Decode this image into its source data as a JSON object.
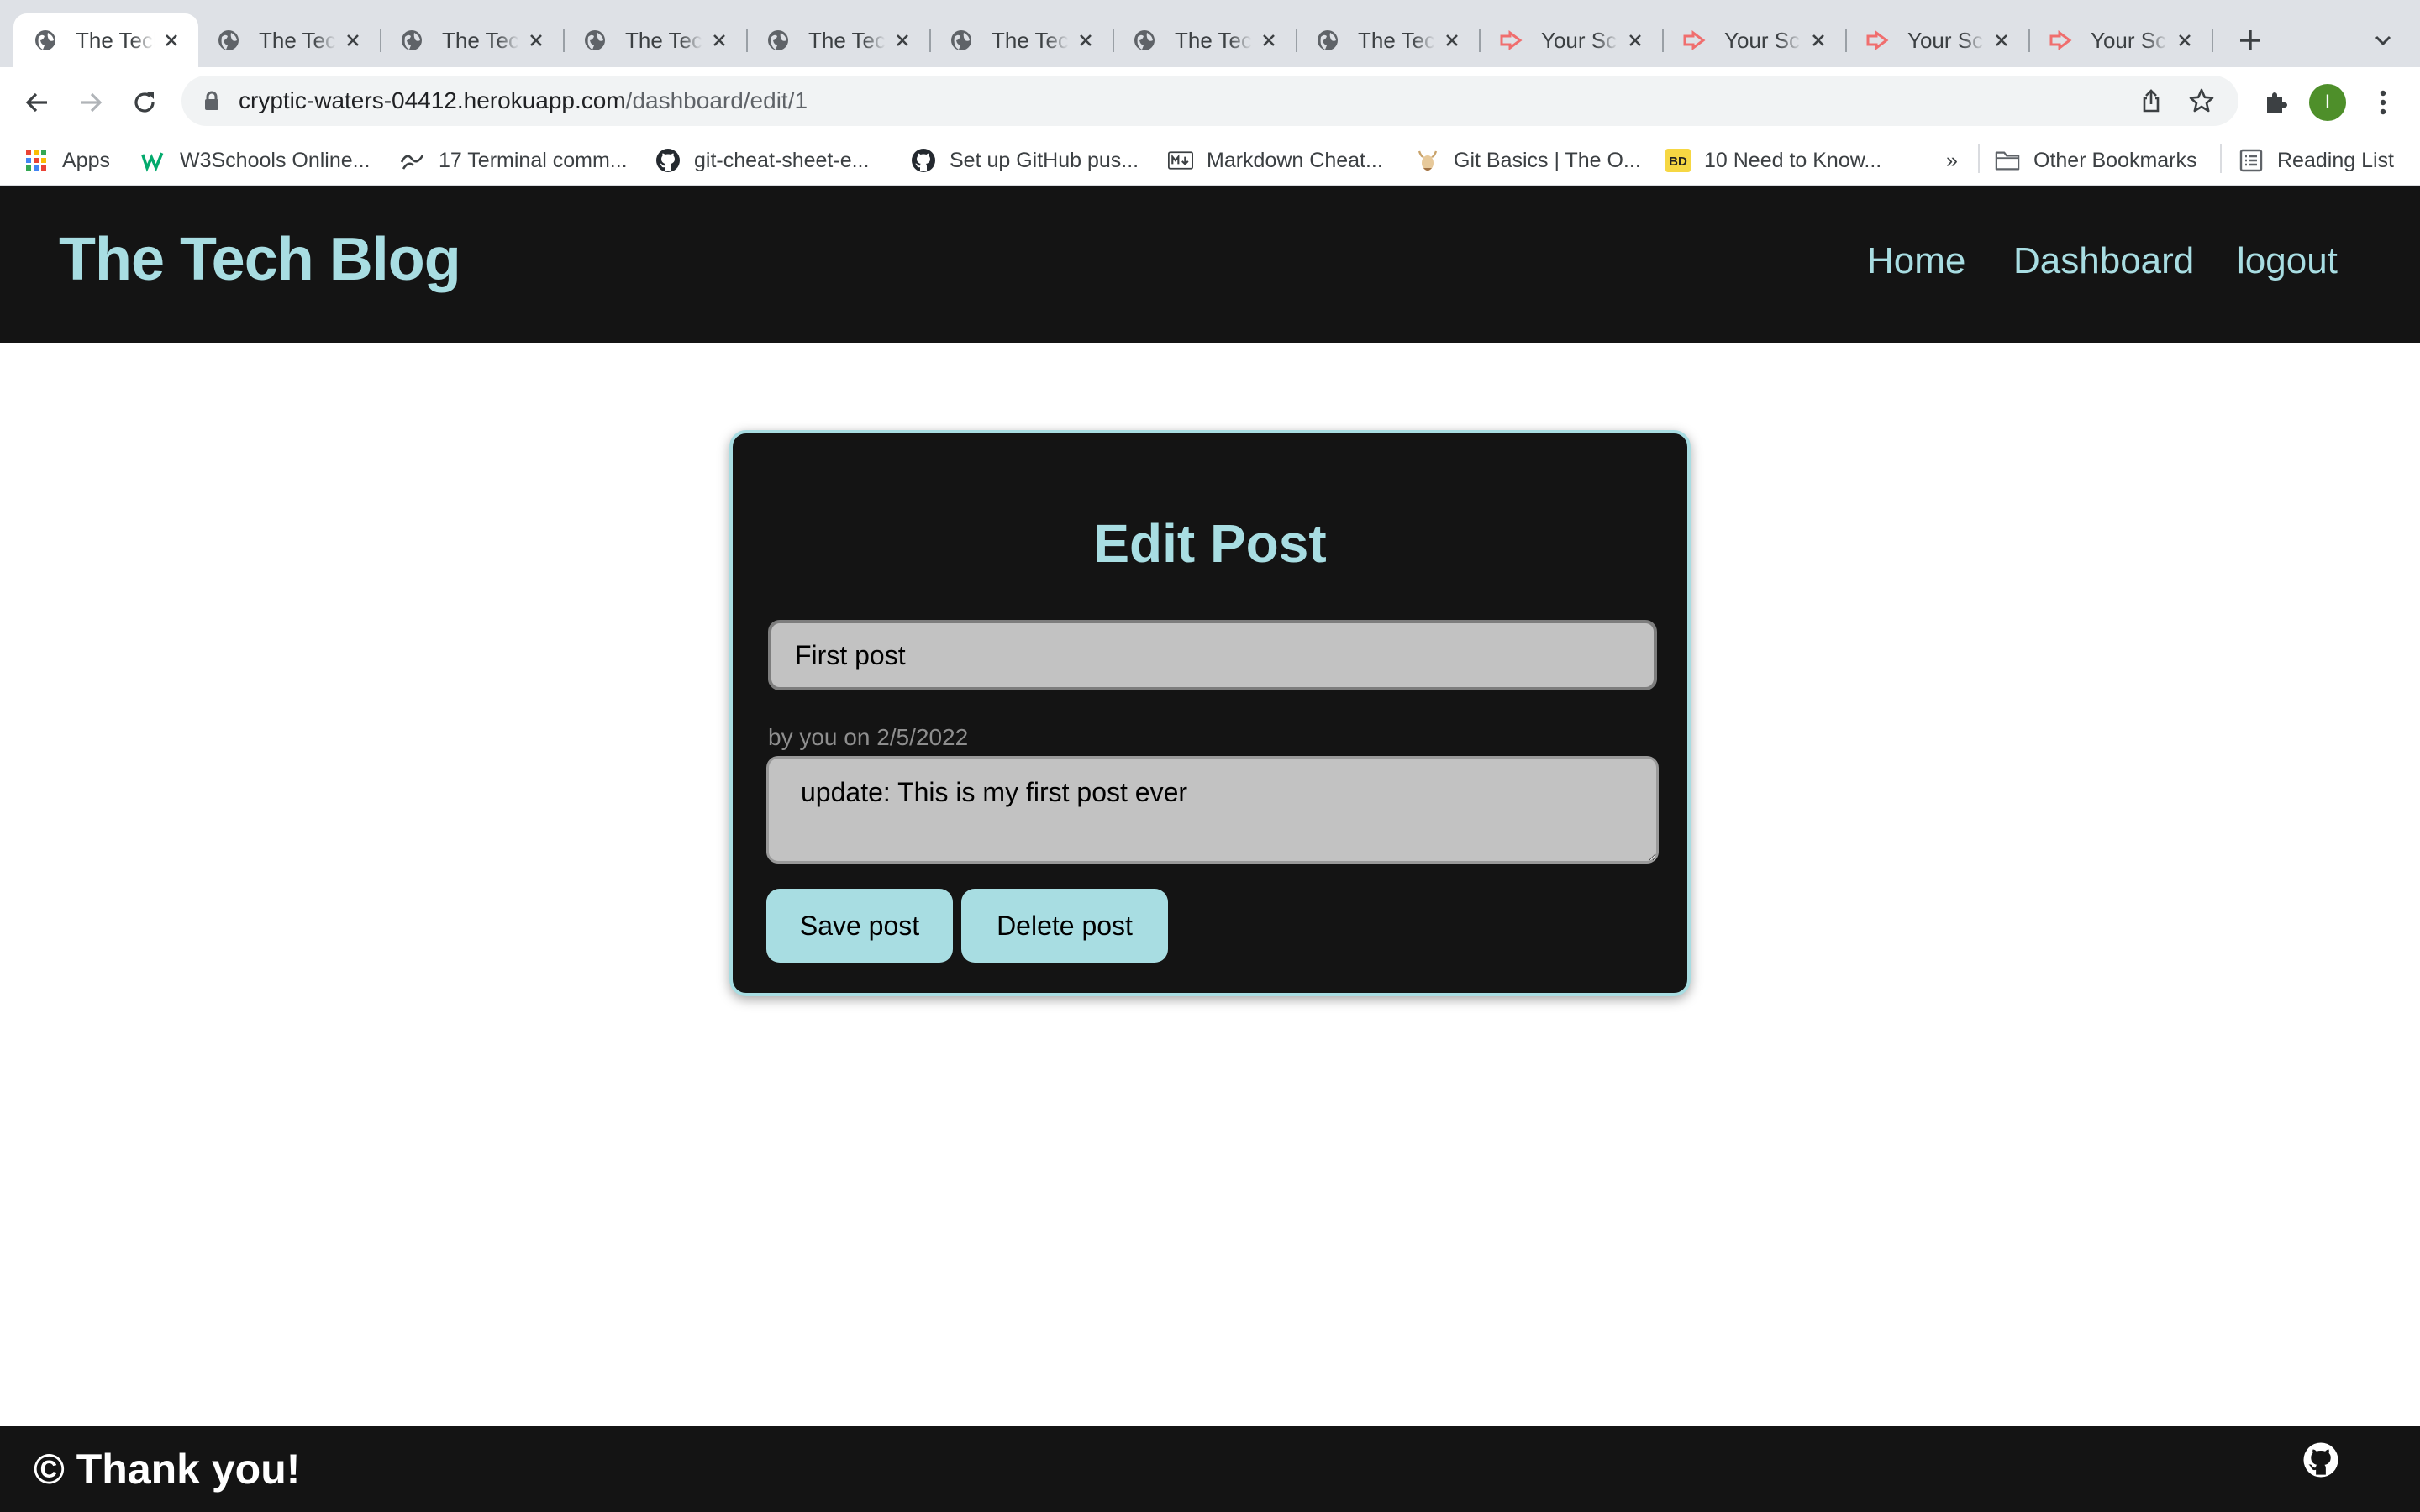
{
  "browser": {
    "tabs": [
      {
        "title": "The Tech Blog",
        "favicon": "globe-icon",
        "active": true
      },
      {
        "title": "The Tech Blog",
        "favicon": "globe-icon",
        "active": false
      },
      {
        "title": "The Tech Blog",
        "favicon": "globe-icon",
        "active": false
      },
      {
        "title": "The Tech Blog",
        "favicon": "globe-icon",
        "active": false
      },
      {
        "title": "The Tech Blog",
        "favicon": "globe-icon",
        "active": false
      },
      {
        "title": "The Tech Blog",
        "favicon": "globe-icon",
        "active": false
      },
      {
        "title": "The Tech Blog",
        "favicon": "globe-icon",
        "active": false
      },
      {
        "title": "The Tech Blog",
        "favicon": "globe-icon",
        "active": false
      },
      {
        "title": "Your Screencastify Video",
        "favicon": "screencastify-icon",
        "active": false
      },
      {
        "title": "Your Screencastify Video",
        "favicon": "screencastify-icon",
        "active": false
      },
      {
        "title": "Your Screencastify Video",
        "favicon": "screencastify-icon",
        "active": false
      },
      {
        "title": "Your Screencastify Video",
        "favicon": "screencastify-icon",
        "active": false
      }
    ],
    "url_host": "cryptic-waters-04412.herokuapp.com",
    "url_path": "/dashboard/edit/1",
    "profile_initial": "I",
    "bookmarks": [
      {
        "label": "Apps",
        "icon": "apps-grid-icon"
      },
      {
        "label": "W3Schools Online...",
        "icon": "w3schools-icon"
      },
      {
        "label": "17 Terminal comm...",
        "icon": "terminal-wave-icon"
      },
      {
        "label": "git-cheat-sheet-e...",
        "icon": "github-icon"
      },
      {
        "label": "Set up GitHub pus...",
        "icon": "github-icon"
      },
      {
        "label": "Markdown Cheat...",
        "icon": "markdown-icon"
      },
      {
        "label": "Git Basics | The O...",
        "icon": "odin-icon"
      },
      {
        "label": "10 Need to Know...",
        "icon": "bd-icon"
      }
    ],
    "overflow_label": "»",
    "other_bookmarks_label": "Other Bookmarks",
    "reading_list_label": "Reading List"
  },
  "site": {
    "title": "The Tech Blog",
    "nav": [
      "Home",
      "Dashboard",
      "logout"
    ]
  },
  "edit_post": {
    "heading": "Edit Post",
    "title_value": "First post",
    "byline": "by you on 2/5/2022",
    "body_value": "update: This is my first post ever",
    "save_label": "Save post",
    "delete_label": "Delete post"
  },
  "footer": {
    "text": "© Thank you!",
    "icon": "github-icon"
  },
  "colors": {
    "accent": "#a8dde2",
    "dark": "#141414",
    "input_bg": "#c2c2c2",
    "byline": "#8e8e8e",
    "tabstrip": "#dee1e6"
  }
}
